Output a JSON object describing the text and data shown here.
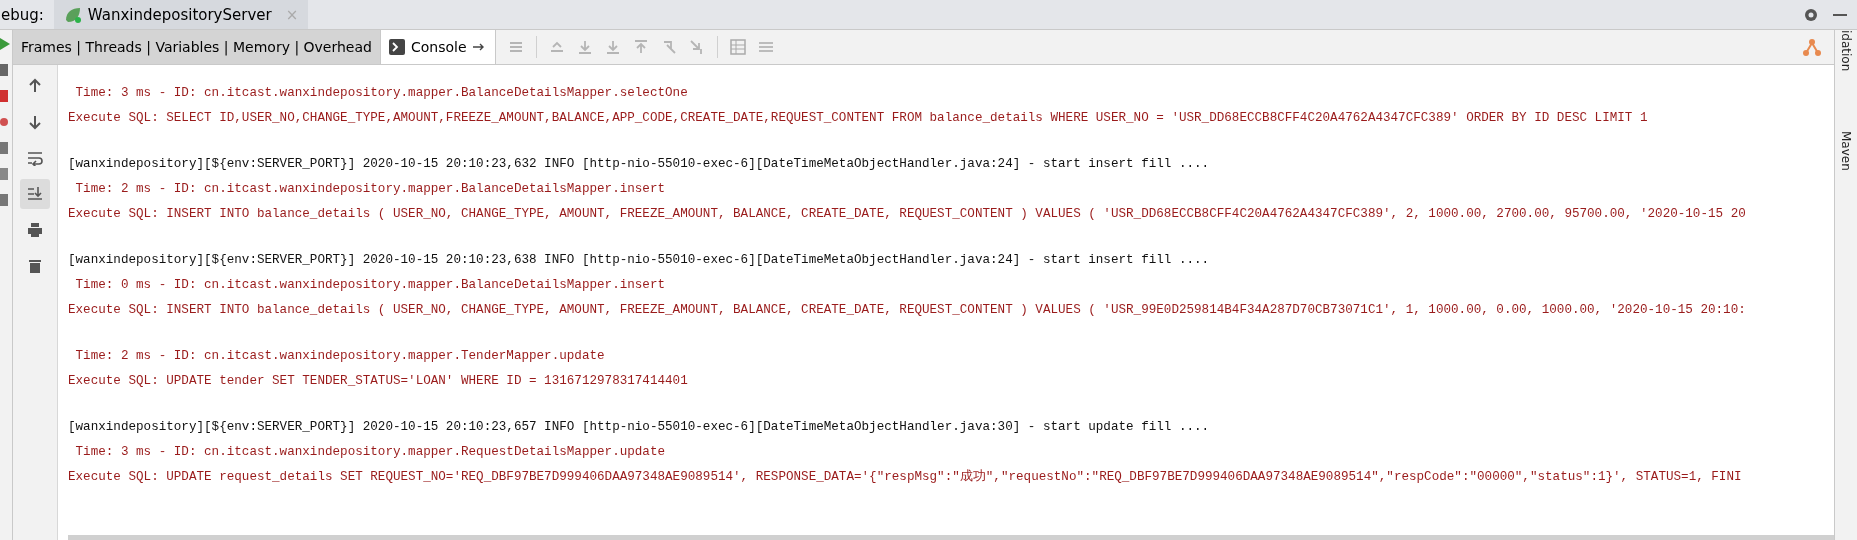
{
  "window": {
    "label": "ebug:"
  },
  "run_tab": {
    "title": "WanxindepositoryServer",
    "close": "×"
  },
  "side_tabs": [
    "idation",
    "Maven"
  ],
  "console_tabs": [
    {
      "label": "Frames | Threads | Variables | Memory | Overhead",
      "selected": false
    },
    {
      "label": "Console",
      "selected": true
    }
  ],
  "gutter_tools": [
    {
      "kind": "up",
      "on": false
    },
    {
      "kind": "down",
      "on": false
    },
    {
      "kind": "wrap",
      "on": false
    },
    {
      "kind": "scroll-end",
      "on": true
    },
    {
      "kind": "print",
      "on": false
    },
    {
      "kind": "trash",
      "on": false
    }
  ],
  "console_lines": [
    {
      "kind": "sql",
      "text": " Time: 3 ms - ID: cn.itcast.wanxindepository.mapper.BalanceDetailsMapper.selectOne"
    },
    {
      "kind": "sql",
      "text": "Execute SQL: SELECT ID,USER_NO,CHANGE_TYPE,AMOUNT,FREEZE_AMOUNT,BALANCE,APP_CODE,CREATE_DATE,REQUEST_CONTENT FROM balance_details WHERE USER_NO = 'USR_DD68ECCB8CFF4C20A4762A4347CFC389' ORDER BY ID DESC LIMIT 1"
    },
    {
      "kind": "blank"
    },
    {
      "kind": "info",
      "text": "[wanxindepository][${env:SERVER_PORT}] 2020-10-15 20:10:23,632 INFO [http-nio-55010-exec-6][DateTimeMetaObjectHandler.java:24] - start insert fill ...."
    },
    {
      "kind": "sql",
      "text": " Time: 2 ms - ID: cn.itcast.wanxindepository.mapper.BalanceDetailsMapper.insert"
    },
    {
      "kind": "sql",
      "text": "Execute SQL: INSERT INTO balance_details ( USER_NO, CHANGE_TYPE, AMOUNT, FREEZE_AMOUNT, BALANCE, CREATE_DATE, REQUEST_CONTENT ) VALUES ( 'USR_DD68ECCB8CFF4C20A4762A4347CFC389', 2, 1000.00, 2700.00, 95700.00, '2020-10-15 20"
    },
    {
      "kind": "blank"
    },
    {
      "kind": "info",
      "text": "[wanxindepository][${env:SERVER_PORT}] 2020-10-15 20:10:23,638 INFO [http-nio-55010-exec-6][DateTimeMetaObjectHandler.java:24] - start insert fill ...."
    },
    {
      "kind": "sql",
      "text": " Time: 0 ms - ID: cn.itcast.wanxindepository.mapper.BalanceDetailsMapper.insert"
    },
    {
      "kind": "sql",
      "text": "Execute SQL: INSERT INTO balance_details ( USER_NO, CHANGE_TYPE, AMOUNT, FREEZE_AMOUNT, BALANCE, CREATE_DATE, REQUEST_CONTENT ) VALUES ( 'USR_99E0D259814B4F34A287D70CB73071C1', 1, 1000.00, 0.00, 1000.00, '2020-10-15 20:10:"
    },
    {
      "kind": "blank"
    },
    {
      "kind": "sql",
      "text": " Time: 2 ms - ID: cn.itcast.wanxindepository.mapper.TenderMapper.update"
    },
    {
      "kind": "sql",
      "text": "Execute SQL: UPDATE tender SET TENDER_STATUS='LOAN' WHERE ID = 1316712978317414401"
    },
    {
      "kind": "blank"
    },
    {
      "kind": "info",
      "text": "[wanxindepository][${env:SERVER_PORT}] 2020-10-15 20:10:23,657 INFO [http-nio-55010-exec-6][DateTimeMetaObjectHandler.java:30] - start update fill ...."
    },
    {
      "kind": "sql",
      "text": " Time: 3 ms - ID: cn.itcast.wanxindepository.mapper.RequestDetailsMapper.update"
    },
    {
      "kind": "sql",
      "text": "Execute SQL: UPDATE request_details SET REQUEST_NO='REQ_DBF97BE7D999406DAA97348AE9089514', RESPONSE_DATA='{\"respMsg\":\"成功\",\"requestNo\":\"REQ_DBF97BE7D999406DAA97348AE9089514\",\"respCode\":\"00000\",\"status\":1}', STATUS=1, FINI"
    }
  ]
}
